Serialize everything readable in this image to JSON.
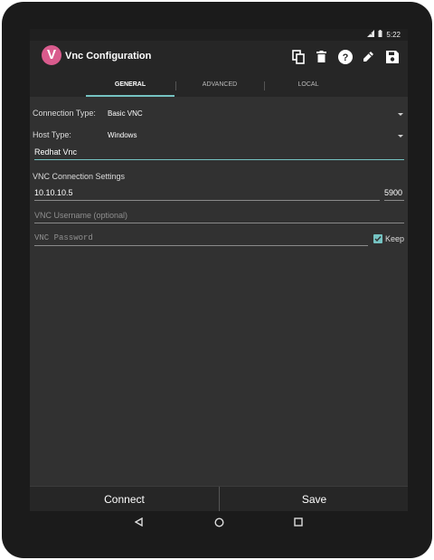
{
  "status": {
    "time": "5:22"
  },
  "app": {
    "title": "Vnc Configuration",
    "icon_letter": "V"
  },
  "toolbar": {
    "actions": [
      "copy-icon",
      "delete-icon",
      "help-icon",
      "pencil-icon",
      "save-icon"
    ]
  },
  "tabs": [
    {
      "label": "GENERAL",
      "active": true
    },
    {
      "label": "ADVANCED",
      "active": false
    },
    {
      "label": "LOCAL",
      "active": false
    }
  ],
  "form": {
    "connection_type_label": "Connection Type:",
    "connection_type_value": "Basic VNC",
    "host_type_label": "Host Type:",
    "host_type_value": "Windows",
    "nickname_value": "Redhat Vnc",
    "section_title": "VNC Connection Settings",
    "address_value": "10.10.10.5",
    "port_value": "5900",
    "username_placeholder": "VNC Username (optional)",
    "password_placeholder": "VNC Password",
    "keep_label": "Keep",
    "keep_checked": true
  },
  "bottom_buttons": {
    "connect": "Connect",
    "save": "Save"
  },
  "colors": {
    "accent": "#75c3c2",
    "app_icon": "#d95b8d",
    "background": "#313131",
    "bar": "#262626"
  }
}
